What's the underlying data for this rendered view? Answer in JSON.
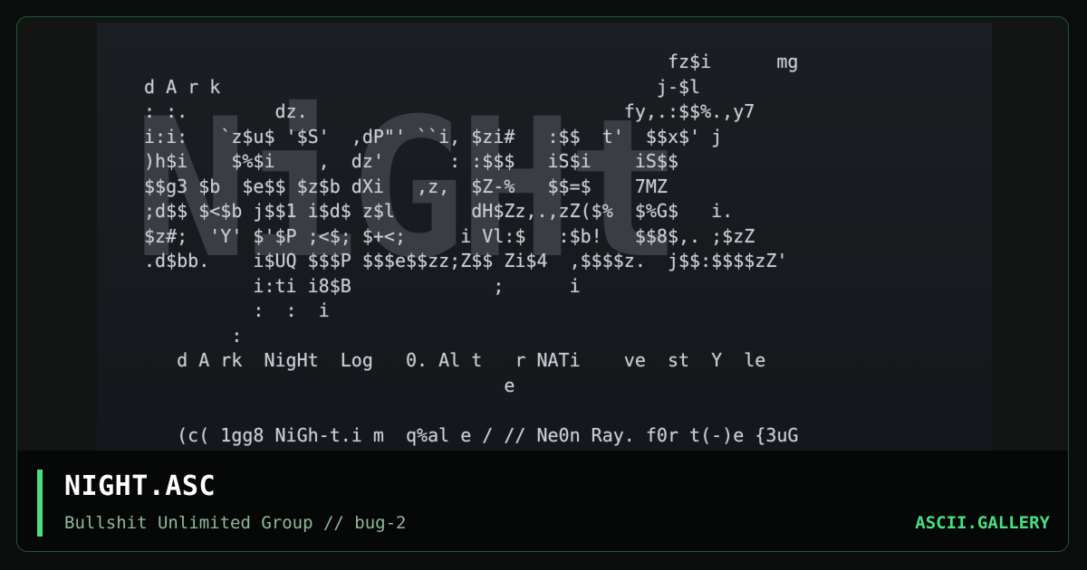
{
  "artwork": {
    "backdrop_text": "NiGHt",
    "lines": [
      "                                                fz$i      mg",
      "d A r k                                        j-$l",
      ": :.        dz.                             fy,.:$$%.,y7",
      "i:i:   `z$u$ '$S'  ,dP\"' ``i, $zi#   :$$  t'  $$x$' j",
      ")h$i    $%$i    ,  dz'      : :$$$   iS$i    iS$$",
      "$$g3 $b  $e$$ $z$b dXi   ,z,  $Z-%   $$=$    7MZ",
      ";d$$ $<$b j$$1 i$d$ z$l       dH$Zz,.,zZ($%  $%G$   i.",
      "$z#;  'Y' $'$P ;<$; $+<;     i Vl:$   :$b!   $$8$,. ;$zZ",
      ".d$bb.    i$UQ $$$P $$$e$$zz;Z$$ Zi$4  ,$$$$z.  j$$:$$$$zZ'",
      "          i:ti i8$B             ;      i",
      "          :  :  i",
      "        :",
      "   d A rk  NigHt  Log   0. Al t   r NATi    ve  st  Y  le",
      "                                 e",
      "",
      "   (c( 1gg8 NiGh-t.i m  q%al e / // Ne0n Ray. f0r t(-)e {3uG"
    ]
  },
  "info": {
    "title": "NIGHT.ASC",
    "meta": "Bullshit Unlimited Group // bug-2",
    "site": "ASCII.GALLERY"
  },
  "colors": {
    "accent": "#4ade80",
    "background": "#0b0d0c",
    "art_text": "#c9cdd2"
  }
}
